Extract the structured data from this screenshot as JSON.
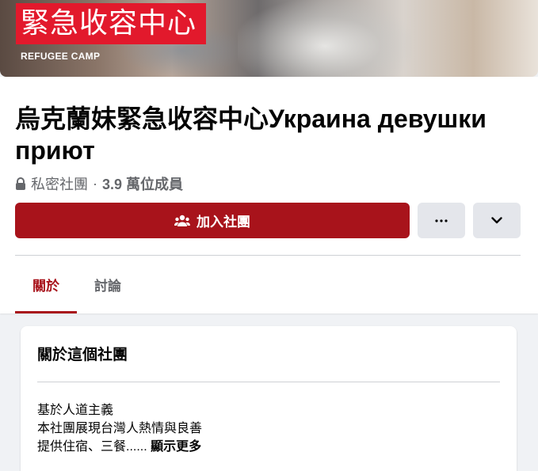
{
  "cover": {
    "banner_text": "緊急收容中心",
    "sub_text": "REFUGEE CAMP"
  },
  "group": {
    "title": "烏克蘭妹緊急收容中心Украина девушки приют",
    "privacy": "私密社團",
    "separator": "·",
    "member_count": "3.9 萬位成員"
  },
  "actions": {
    "join_label": "加入社團",
    "join_icon": "group-people-icon",
    "more_icon": "ellipsis-icon",
    "dropdown_icon": "chevron-down-icon"
  },
  "tabs": [
    {
      "label": "關於",
      "active": true
    },
    {
      "label": "討論",
      "active": false
    }
  ],
  "about": {
    "title": "關於這個社團",
    "lines": [
      "基於人道主義",
      "本社團展現台灣人熱情與良善",
      "提供住宿、三餐......"
    ],
    "see_more": "顯示更多"
  },
  "colors": {
    "accent": "#a8131b",
    "banner_red": "#e2192c",
    "secondary_text": "#65676b",
    "page_bg": "#f0f2f5"
  }
}
